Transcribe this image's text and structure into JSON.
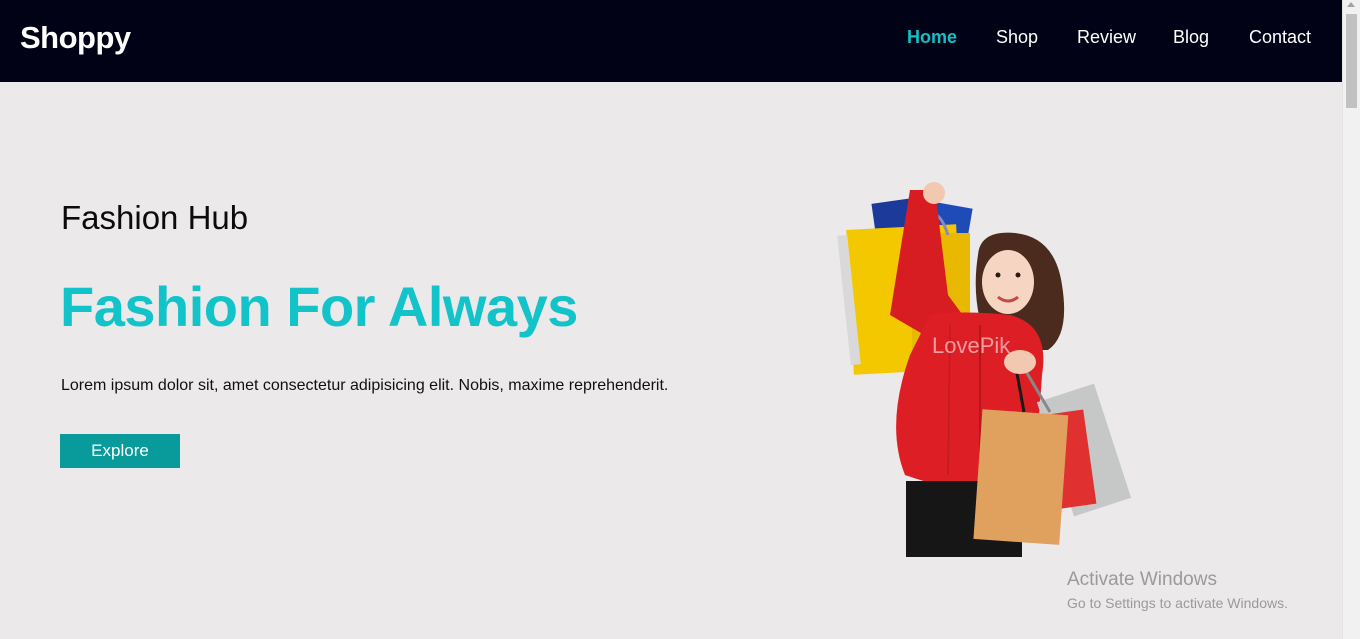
{
  "navbar": {
    "brand": "Shoppy",
    "items": [
      {
        "label": "Home",
        "active": true
      },
      {
        "label": "Shop",
        "active": false
      },
      {
        "label": "Review",
        "active": false
      },
      {
        "label": "Blog",
        "active": false
      },
      {
        "label": "Contact",
        "active": false
      }
    ]
  },
  "hero": {
    "subtitle": "Fashion Hub",
    "title": "Fashion For Always",
    "text": "Lorem ipsum dolor sit, amet consectetur adipisicing elit. Nobis, maxime reprehenderit.",
    "button_label": "Explore",
    "image_watermark": "LovePik"
  },
  "windows_watermark": {
    "title": "Activate Windows",
    "subtitle": "Go to Settings to activate Windows."
  },
  "colors": {
    "navbar_bg": "#020216",
    "page_bg": "#ebe9ea",
    "accent": "#12c4c9",
    "button_bg": "#099a9c"
  }
}
